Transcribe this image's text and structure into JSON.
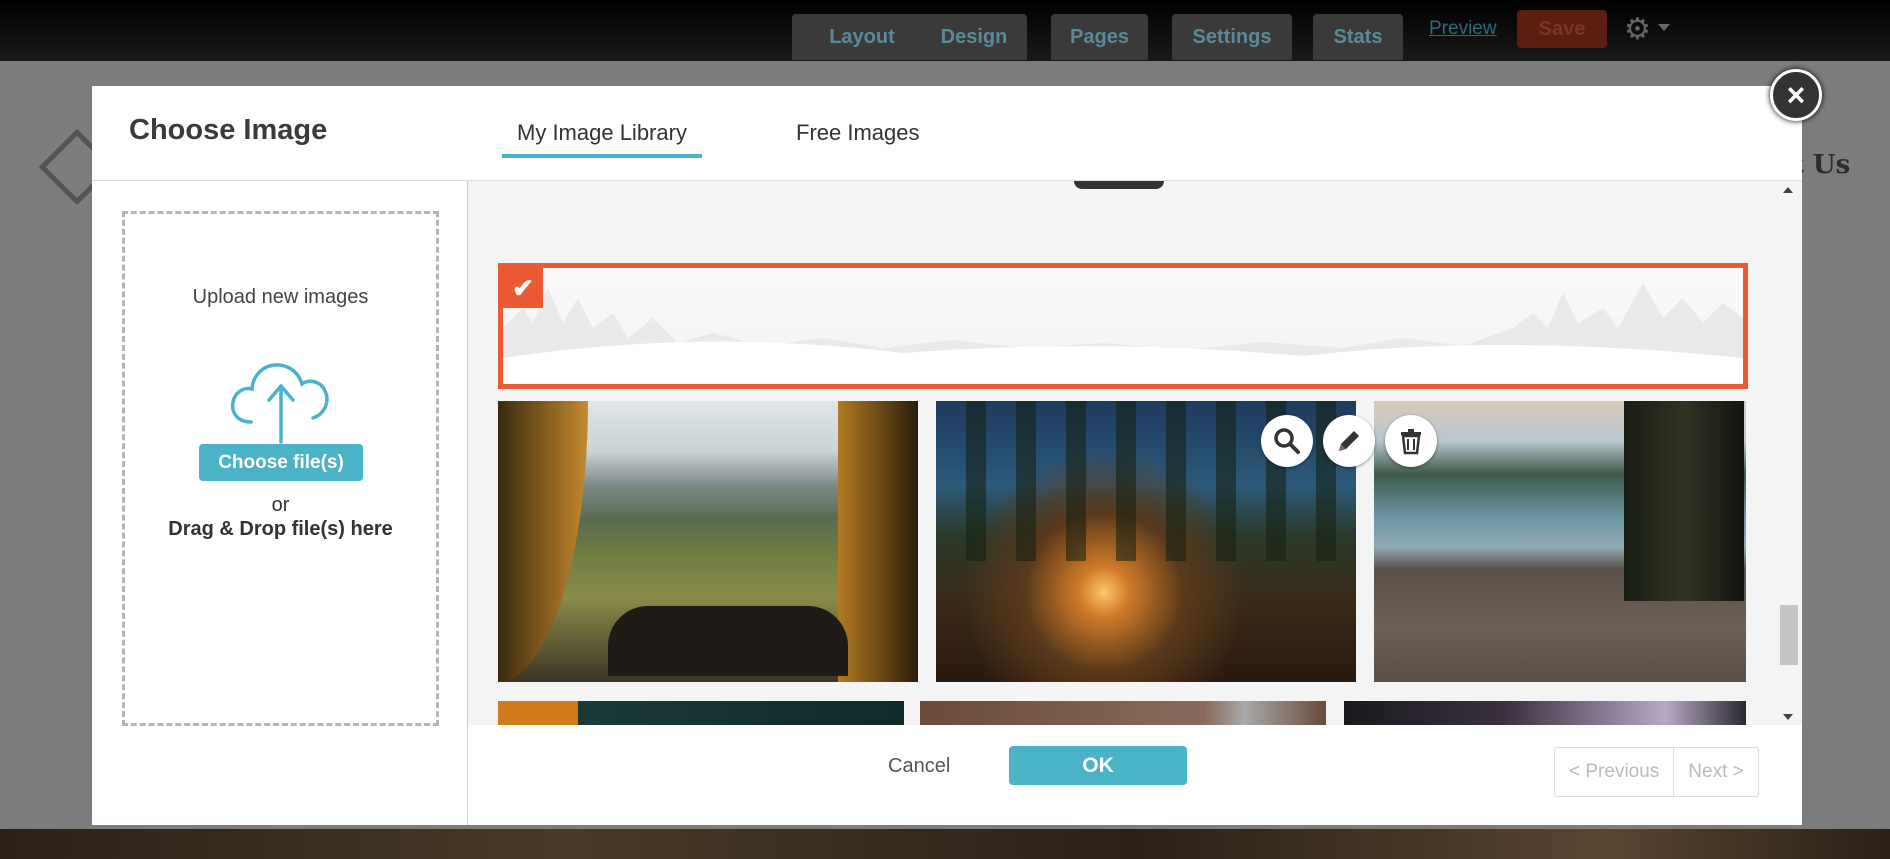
{
  "topbar": {
    "buttons": [
      "Layout",
      "Design",
      "Pages",
      "Settings",
      "Stats"
    ],
    "preview_label": "Preview",
    "save_label": "Save"
  },
  "background": {
    "nav_contact": "ct Us"
  },
  "modal": {
    "title": "Choose Image",
    "tabs": [
      {
        "label": "My Image Library",
        "active": true
      },
      {
        "label": "Free Images",
        "active": false
      }
    ],
    "close_label": "×"
  },
  "upload": {
    "label": "Upload new images",
    "choose_button": "Choose file(s)",
    "or_text": "or",
    "drag_drop_text": "Drag & Drop file(s) here"
  },
  "gallery": {
    "selected_index": 0,
    "accent_color": "#ea5a35",
    "tools": [
      "search-icon",
      "pencil-icon",
      "trash-icon"
    ]
  },
  "footer": {
    "cancel_label": "Cancel",
    "ok_label": "OK",
    "previous_label": "< Previous",
    "next_label": "Next >"
  },
  "colors": {
    "primary": "#4bb3c8",
    "selection": "#ea5a35"
  }
}
